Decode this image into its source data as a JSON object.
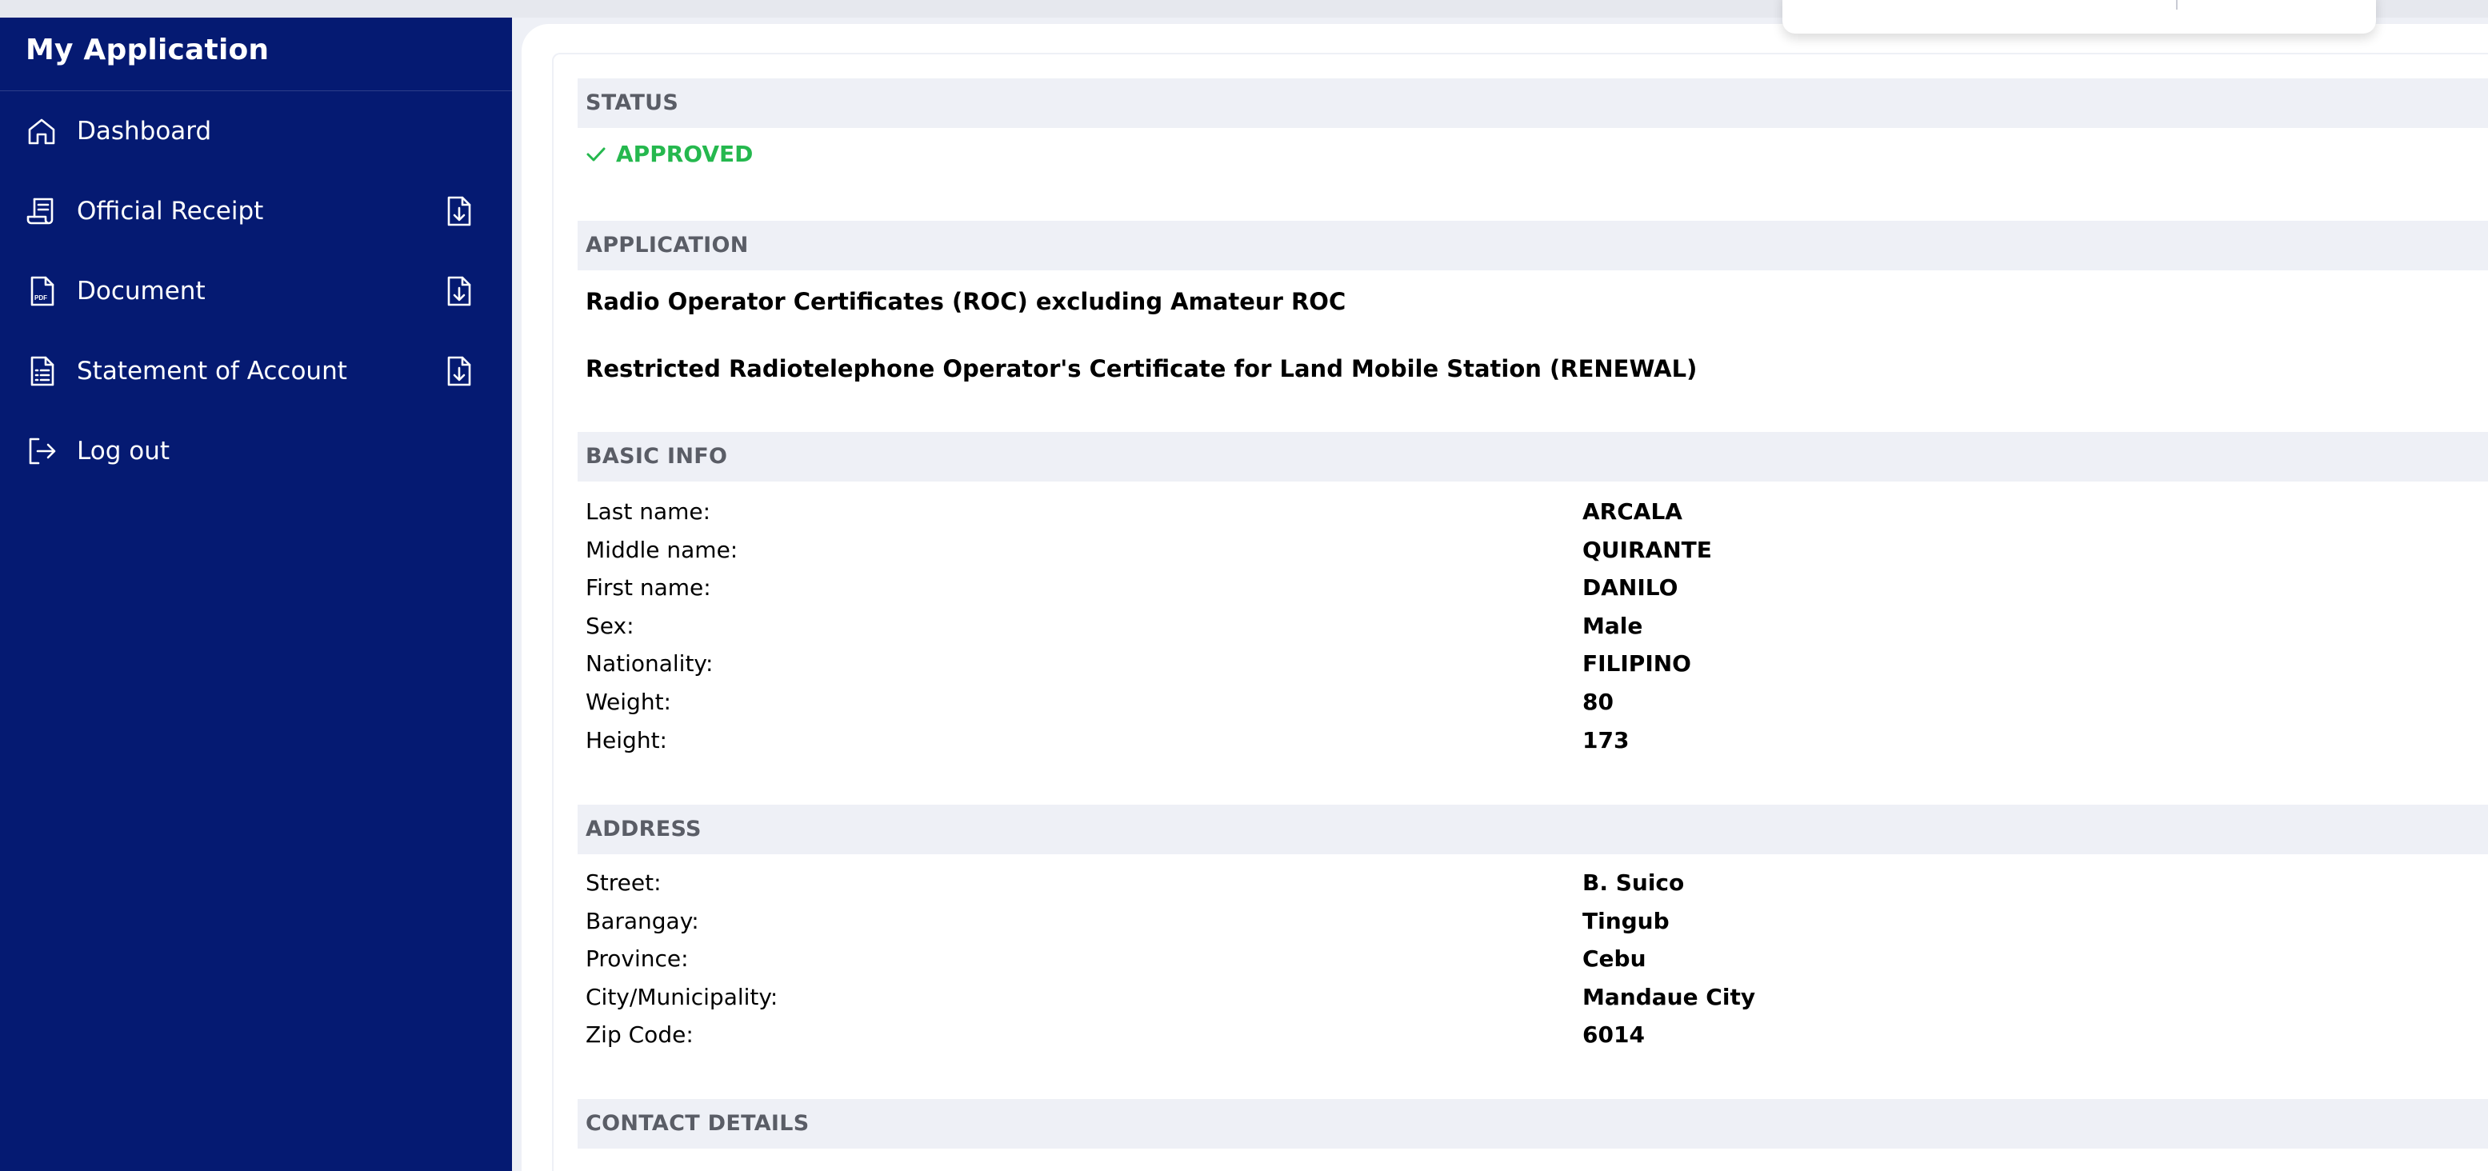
{
  "sidebar": {
    "title": "My Application",
    "items": [
      {
        "label": "Dashboard",
        "icon": "home-icon"
      },
      {
        "label": "Official Receipt",
        "icon": "receipt-icon",
        "download": true
      },
      {
        "label": "Document",
        "icon": "pdf-file-icon",
        "download": true
      },
      {
        "label": "Statement of Account",
        "icon": "statement-icon",
        "download": true
      },
      {
        "label": "Log out",
        "icon": "logout-icon"
      }
    ],
    "colors": {
      "background": "#051a72",
      "text": "#ffffff"
    }
  },
  "status": {
    "heading": "STATUS",
    "value": "APPROVED",
    "color": "#25b84e"
  },
  "application": {
    "heading": "APPLICATION",
    "title": "Radio Operator Certificates (ROC) excluding Amateur ROC",
    "subtitle": "Restricted Radiotelephone Operator's Certificate for Land Mobile Station (RENEWAL)"
  },
  "basic_info": {
    "heading": "BASIC INFO",
    "rows": [
      {
        "label": "Last name:",
        "value": "ARCALA"
      },
      {
        "label": "Middle name:",
        "value": "QUIRANTE"
      },
      {
        "label": "First name:",
        "value": "DANILO"
      },
      {
        "label": "Sex:",
        "value": "Male"
      },
      {
        "label": "Nationality:",
        "value": "FILIPINO"
      },
      {
        "label": "Weight:",
        "value": "80"
      },
      {
        "label": "Height:",
        "value": "173"
      }
    ]
  },
  "address": {
    "heading": "ADDRESS",
    "rows": [
      {
        "label": "Street:",
        "value": "B. Suico"
      },
      {
        "label": "Barangay:",
        "value": "Tingub"
      },
      {
        "label": "Province:",
        "value": "Cebu"
      },
      {
        "label": "City/Municipality:",
        "value": "Mandaue City"
      },
      {
        "label": "Zip Code:",
        "value": "6014"
      }
    ]
  },
  "contact_details": {
    "heading": "CONTACT DETAILS"
  }
}
